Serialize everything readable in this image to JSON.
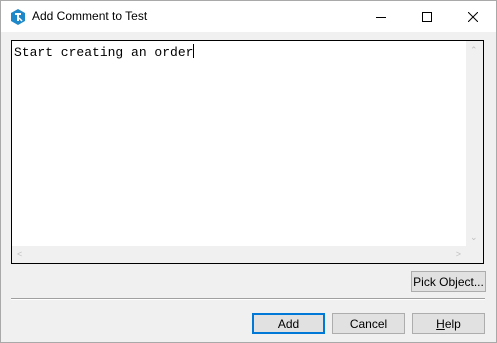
{
  "window": {
    "title": "Add Comment to Test",
    "app_icon": "testcomplete-logo-icon",
    "controls": [
      "minimize-icon",
      "maximize-icon",
      "close-icon"
    ]
  },
  "editor": {
    "text": "Start creating an order"
  },
  "buttons": {
    "pick_object": "Pick Object...",
    "add": "Add",
    "cancel": "Cancel",
    "help_prefix": "",
    "help_underlined": "H",
    "help_rest": "elp"
  },
  "colors": {
    "dialog_background": "#f0f0f0",
    "titlebar_background": "#ffffff",
    "default_button_border": "#0078d7",
    "button_face": "#e1e1e1",
    "app_icon_blue": "#1e88c8"
  }
}
